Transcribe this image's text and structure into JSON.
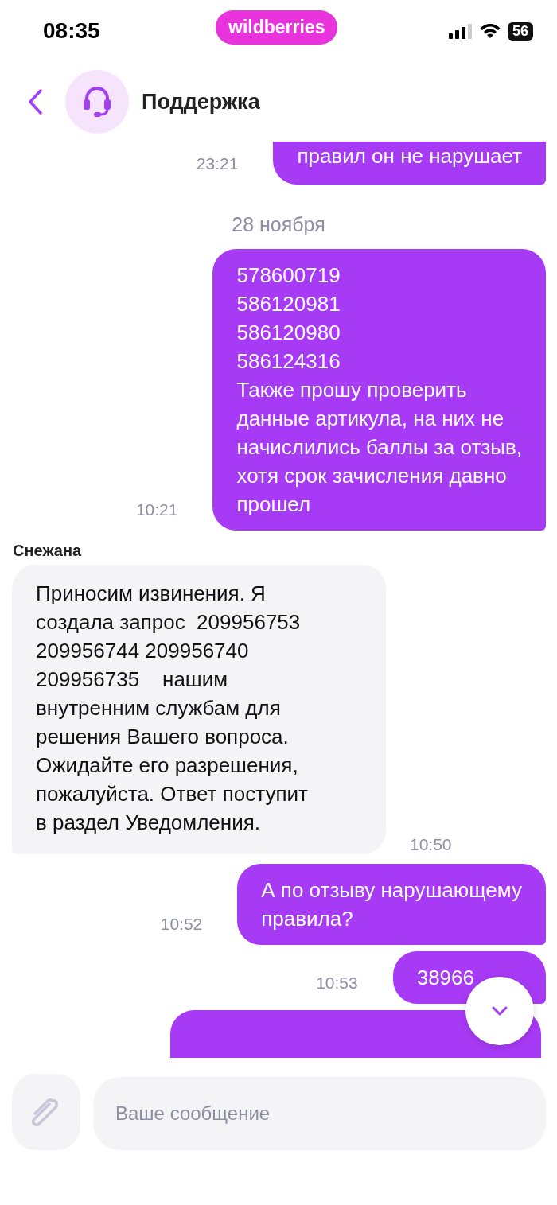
{
  "status_bar": {
    "time": "08:35",
    "brand": "wildberries",
    "battery": "56"
  },
  "header": {
    "title": "Поддержка"
  },
  "messages": [
    {
      "kind": "outgoing",
      "clipped_top": true,
      "text": "правил он не нарушает",
      "time": "23:21"
    },
    {
      "kind": "date",
      "text": "28 ноября"
    },
    {
      "kind": "outgoing",
      "text": "578600719\n586120981\n586120980\n586124316\nТакже прошу проверить\nданные артикула, на них не\nначислились баллы за отзыв,\nхотя срок зачисления давно\nпрошел",
      "time": "10:21"
    },
    {
      "kind": "incoming",
      "author": "Снежана",
      "text": "Приносим извинения. Я\nсоздала запрос  209956753\n209956744 209956740\n209956735    нашим\nвнутренним службам для\nрешения Вашего вопроса.\nОжидайте его разрешения,\nпожалуйста. Ответ поступит\nв раздел Уведомления.",
      "time": "10:50"
    },
    {
      "kind": "outgoing",
      "text": "А по отзыву нарушающему\nправила?",
      "time": "10:52"
    },
    {
      "kind": "outgoing",
      "text": "38966",
      "time": "10:53",
      "wide": true
    },
    {
      "kind": "clipped"
    }
  ],
  "composer": {
    "placeholder": "Ваше сообщение"
  }
}
